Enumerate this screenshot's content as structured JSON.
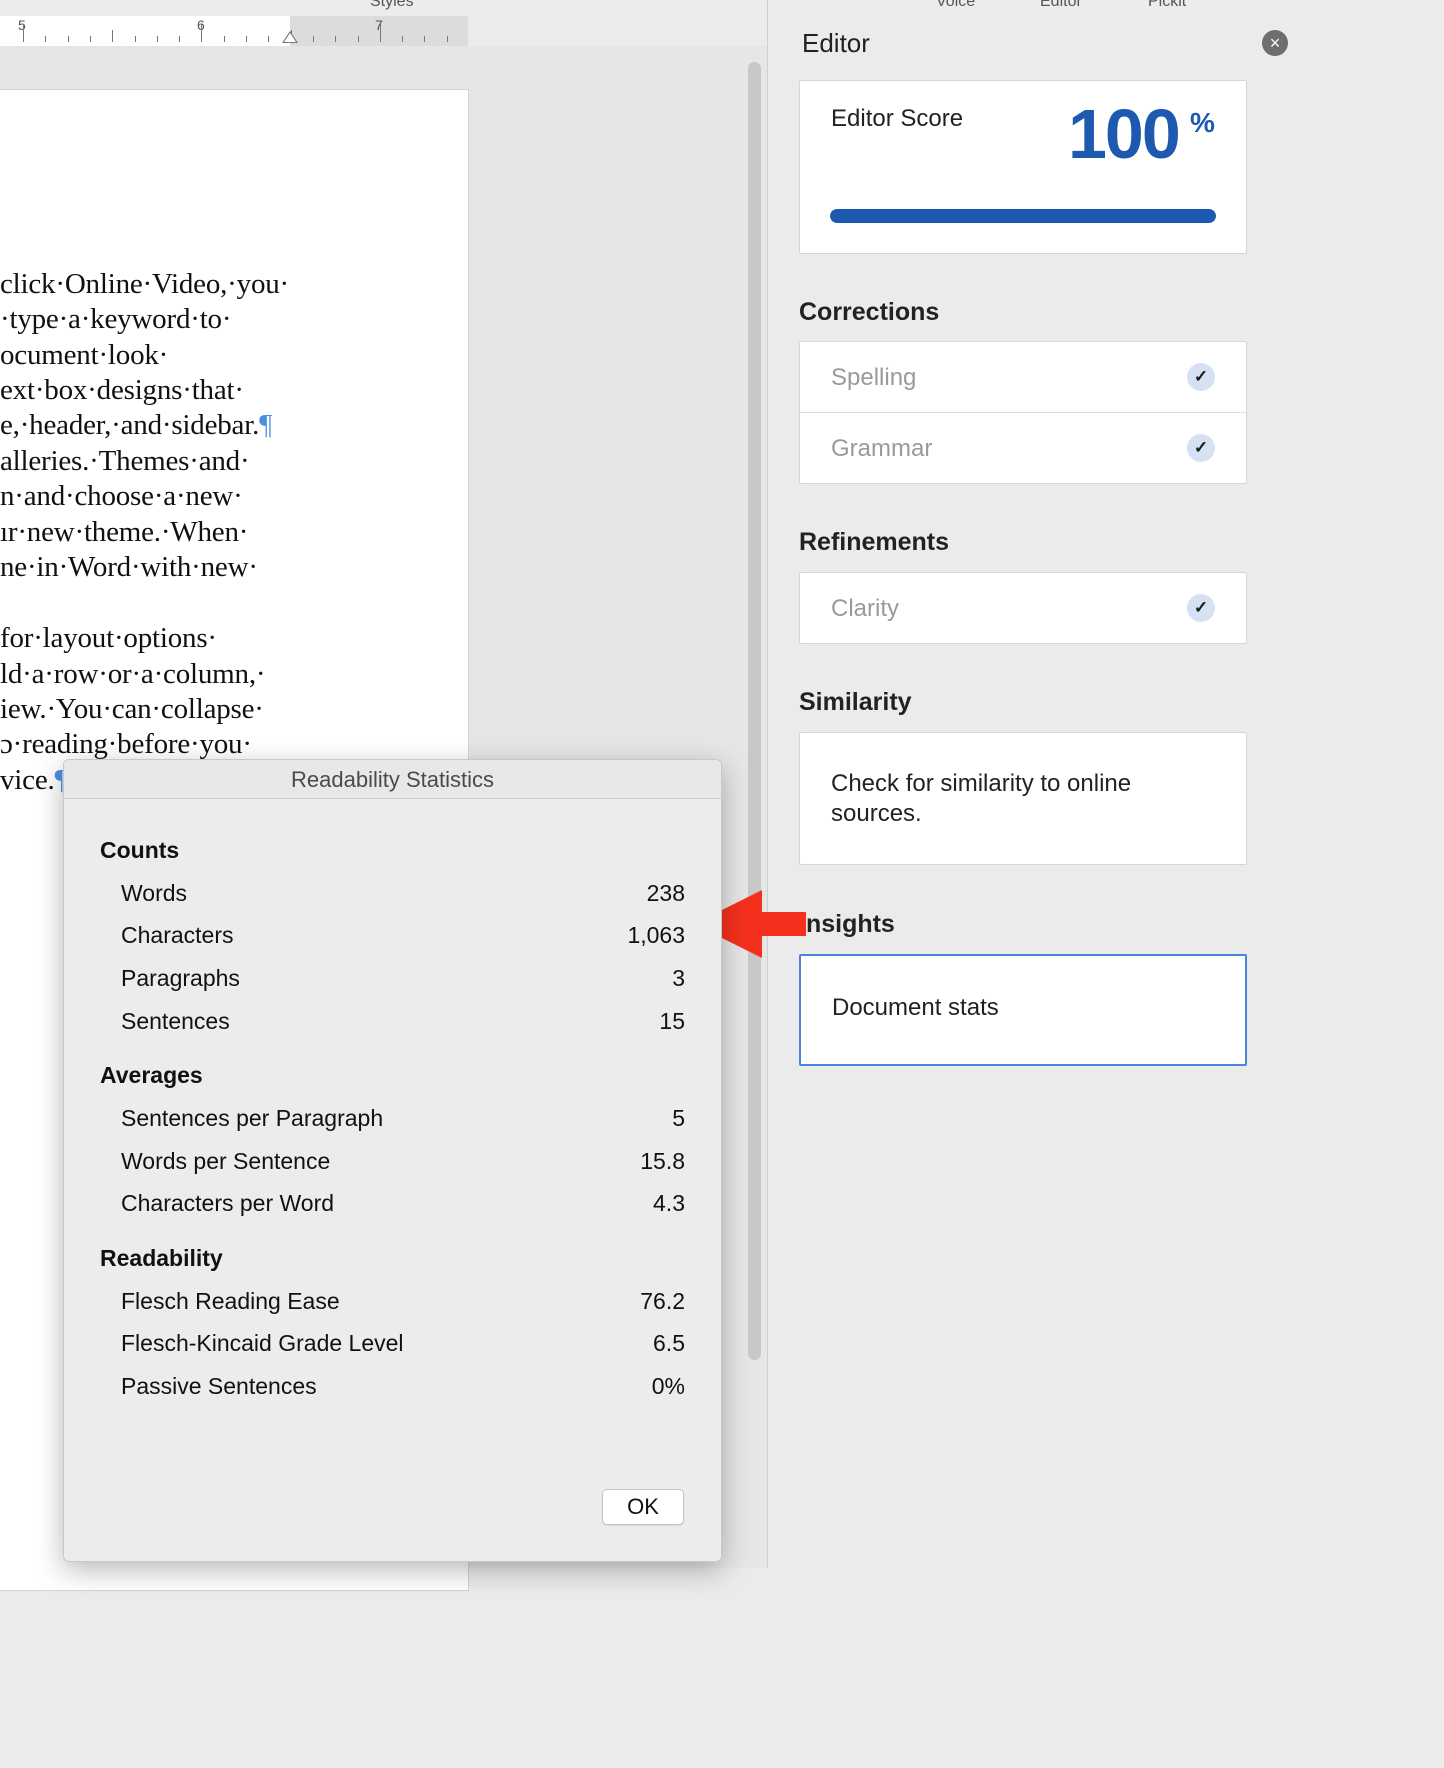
{
  "topbar": {
    "styles": "Styles",
    "voice": "Voice",
    "editor": "Editor",
    "pickit": "Pickit"
  },
  "ruler": {
    "n5": "5",
    "n6": "6",
    "n7": "7"
  },
  "document": {
    "lines": [
      "click·Online·Video,·you·",
      "·type·a·keyword·to·",
      "ocument·look·",
      "ext·box·designs·that·",
      "e,·header,·and·sidebar.",
      "alleries.·Themes·and·",
      "n·and·choose·a·new·",
      "ır·new·theme.·When·",
      "ne·in·Word·with·new·",
      "for·layout·options·",
      "ld·a·row·or·a·column,·",
      "iew.·You·can·collapse·",
      "ɔ·reading·before·you·",
      "vice."
    ],
    "pilcrow": "¶"
  },
  "editor_pane": {
    "title": "Editor",
    "close_icon": "×",
    "score_label": "Editor Score",
    "score_value": "100",
    "score_unit": "%",
    "score_fraction": 1.0,
    "corrections_heading": "Corrections",
    "spelling_label": "Spelling",
    "grammar_label": "Grammar",
    "refinements_heading": "Refinements",
    "clarity_label": "Clarity",
    "check_glyph": "✓",
    "similarity_heading": "Similarity",
    "similarity_text": "Check for similarity to online sources.",
    "insights_heading": "Insights",
    "document_stats_label": "Document stats",
    "accent_color": "#1e59b0"
  },
  "dialog": {
    "title": "Readability Statistics",
    "counts_heading": "Counts",
    "words_label": "Words",
    "words_value": "238",
    "characters_label": "Characters",
    "characters_value": "1,063",
    "paragraphs_label": "Paragraphs",
    "paragraphs_value": "3",
    "sentences_label": "Sentences",
    "sentences_value": "15",
    "averages_heading": "Averages",
    "spp_label": "Sentences per Paragraph",
    "spp_value": "5",
    "wps_label": "Words per Sentence",
    "wps_value": "15.8",
    "cpw_label": "Characters per Word",
    "cpw_value": "4.3",
    "readability_heading": "Readability",
    "fre_label": "Flesch Reading Ease",
    "fre_value": "76.2",
    "fkgl_label": "Flesch-Kincaid Grade Level",
    "fkgl_value": "6.5",
    "passive_label": "Passive Sentences",
    "passive_value": "0%",
    "ok_label": "OK"
  },
  "annotation": {
    "arrow_color": "#f5311d"
  }
}
